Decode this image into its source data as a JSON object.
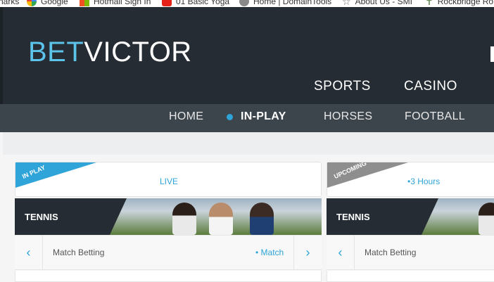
{
  "bookmarks": [
    {
      "label": "narks",
      "icon": ""
    },
    {
      "label": "Google",
      "icon": "google-icon"
    },
    {
      "label": "Hotmail Sign In",
      "icon": "microsoft-icon"
    },
    {
      "label": "01 Basic Yoga",
      "icon": "youtube-icon"
    },
    {
      "label": "Home | DomainTools",
      "icon": "gear-icon"
    },
    {
      "label": "About Us - SMI",
      "icon": "star-icon"
    },
    {
      "label": "Rockbridge Ro",
      "icon": "cross-icon"
    }
  ],
  "brand": {
    "bet": "BET",
    "victor": "VICTOR"
  },
  "top_nav": {
    "sports": "SPORTS",
    "casino": "CASINO"
  },
  "sub_nav": {
    "home": "HOME",
    "in_play": "IN-PLAY",
    "horses": "HORSES",
    "football": "FOOTBALL"
  },
  "cards": [
    {
      "ribbon": "IN PLAY",
      "status": "LIVE",
      "sport": "TENNIS",
      "market": "Match Betting",
      "market_tag": "• Match"
    },
    {
      "ribbon": "UPCOMING",
      "status": "•3 Hours",
      "sport": "TENNIS",
      "market": "Match Betting"
    }
  ],
  "icons": {
    "prev": "‹",
    "next": "›"
  },
  "colors": {
    "accent": "#2ea4d8",
    "header": "#262c33",
    "subnav": "#3c444c"
  }
}
